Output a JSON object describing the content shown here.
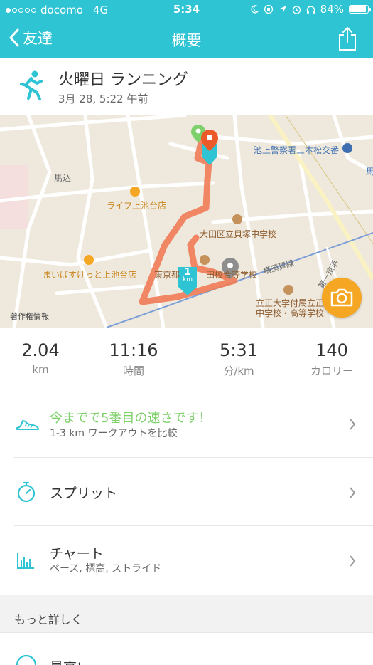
{
  "status_bar": {
    "carrier": "docomo",
    "network": "4G",
    "time": "5:34",
    "battery": "84%"
  },
  "nav": {
    "back_label": "友達",
    "title": "概要"
  },
  "activity": {
    "title": "火曜日 ランニング",
    "date": "3月 28, 5:22 午前"
  },
  "map": {
    "labels": {
      "police": "池上警察署三本松交番",
      "magome": "馬込",
      "life": "ライフ上池台店",
      "school1": "大田区立貝塚中学校",
      "maibasuke": "まいばすけっと上池台店",
      "tokyo": "東京都",
      "school2_part": "田校合等学校",
      "yokosuka": "横須賀線",
      "tokaido": "第一京浜",
      "rissho1": "立正大学付属立正",
      "rissho2": "中学校・高等学校",
      "copyright": "著作権情報",
      "km_marker_number": "1",
      "km_marker_unit": "km",
      "edge": "馬"
    },
    "colors": {
      "route": "#f07b55",
      "start": "#7ed06b",
      "end": "#ec5a2a",
      "marker": "#2ec4d4"
    }
  },
  "stats": [
    {
      "value": "2.04",
      "unit": "km"
    },
    {
      "value": "11:16",
      "unit": "時間"
    },
    {
      "value": "5:31",
      "unit": "分/km"
    },
    {
      "value": "140",
      "unit": "カロリー"
    }
  ],
  "rows": {
    "compare": {
      "title": "今までで5番目の速さです！",
      "subtitle": "1-3 km ワークアウトを比較",
      "color": "#7ed06b"
    },
    "splits": {
      "title": "スプリット"
    },
    "chart": {
      "title": "チャート",
      "subtitle": "ペース, 標高, ストライド"
    }
  },
  "section": {
    "more": "もっと詳しく"
  },
  "partial_row": {
    "title": "最高!"
  },
  "accent": "#2ec4d4"
}
